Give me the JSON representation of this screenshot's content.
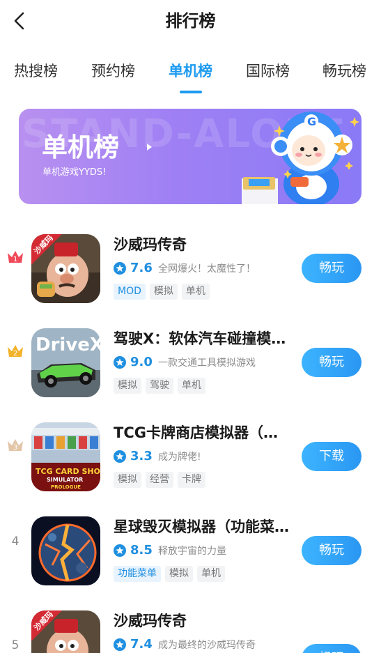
{
  "header": {
    "title": "排行榜",
    "back_icon": "chevron-left-icon"
  },
  "tabs": [
    {
      "label": "热搜榜",
      "active": false
    },
    {
      "label": "预约榜",
      "active": false
    },
    {
      "label": "单机榜",
      "active": true
    },
    {
      "label": "国际榜",
      "active": false
    },
    {
      "label": "畅玩榜",
      "active": false
    }
  ],
  "banner": {
    "bg_text": "STAND-ALONE",
    "title": "单机榜",
    "subtitle": "单机游戏YYDS!",
    "mascot_icon": "astronaut-mascot-icon"
  },
  "colors": {
    "accent": "#1f9bf0",
    "button": "#2a97f2",
    "rank1": "#f04a5a",
    "rank2": "#f2b32a",
    "rank3": "#e3c6a8"
  },
  "apps": [
    {
      "rank": "1",
      "rank_icon": "crown-red-icon",
      "name": "沙威玛传奇",
      "rating": "7.6",
      "desc": "全网爆火！太魔性了！",
      "tags": [
        {
          "label": "MOD",
          "highlight": true
        },
        {
          "label": "模拟",
          "highlight": false
        },
        {
          "label": "单机",
          "highlight": false
        }
      ],
      "action": "畅玩",
      "icon": "shawarma-game-icon"
    },
    {
      "rank": "2",
      "rank_icon": "crown-gold-icon",
      "name": "驾驶X：软体汽车碰撞模拟器",
      "rating": "9.0",
      "desc": "一款交通工具模拟游戏",
      "tags": [
        {
          "label": "模拟",
          "highlight": false
        },
        {
          "label": "驾驶",
          "highlight": false
        },
        {
          "label": "单机",
          "highlight": false
        }
      ],
      "action": "畅玩",
      "icon": "drivex-car-icon",
      "icon_text": "DriveX"
    },
    {
      "rank": "3",
      "rank_icon": "crown-bronze-icon",
      "name": "TCG卡牌商店模拟器（云游戏）",
      "rating": "3.3",
      "desc": "成为牌佬!",
      "tags": [
        {
          "label": "模拟",
          "highlight": false
        },
        {
          "label": "经营",
          "highlight": false
        },
        {
          "label": "卡牌",
          "highlight": false
        }
      ],
      "action": "下载",
      "icon": "tcg-card-shop-icon",
      "icon_text_1": "TCG CARD SHOP",
      "icon_text_2": "SIMULATOR",
      "icon_text_3": "PROLOGUE"
    },
    {
      "rank": "4",
      "name": "星球毁灭模拟器（功能菜单）",
      "rating": "8.5",
      "desc": "释放宇宙的力量",
      "tags": [
        {
          "label": "功能菜单",
          "highlight": true
        },
        {
          "label": "模拟",
          "highlight": false
        },
        {
          "label": "单机",
          "highlight": false
        }
      ],
      "action": "畅玩",
      "icon": "planet-explosion-icon"
    },
    {
      "rank": "5",
      "name": "沙威玛传奇",
      "rating": "7.4",
      "desc": "成为最终的沙威玛传奇",
      "tags": [],
      "action": "畅玩",
      "icon": "shawarma-game-icon"
    }
  ],
  "shawarma_badge": "沙威玛"
}
